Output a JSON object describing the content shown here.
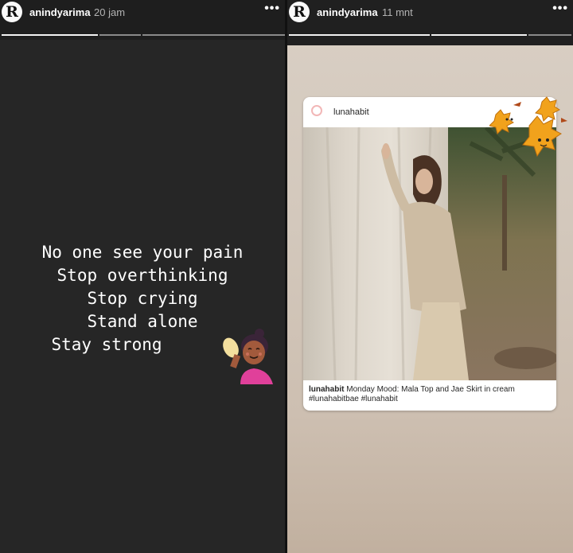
{
  "left_story": {
    "username": "anindyarima",
    "time": "20 jam",
    "more_icon": "more-dots-icon",
    "text_lines": [
      "No one see your pain",
      "Stop overthinking",
      "Stop crying",
      "Stand alone",
      "Stay strong"
    ],
    "sticker": "woman-raising-hand-emoji"
  },
  "right_story": {
    "username": "anindyarima",
    "time": "11 mnt",
    "more_icon": "more-dots-icon",
    "post": {
      "username": "lunahabit",
      "caption_user": "lunahabit",
      "caption_text": "Monday Mood: Mala Top and Jae Skirt in cream #lunahabitbae #lunahabit"
    },
    "sticker": "autumn-leaves-sticker"
  }
}
